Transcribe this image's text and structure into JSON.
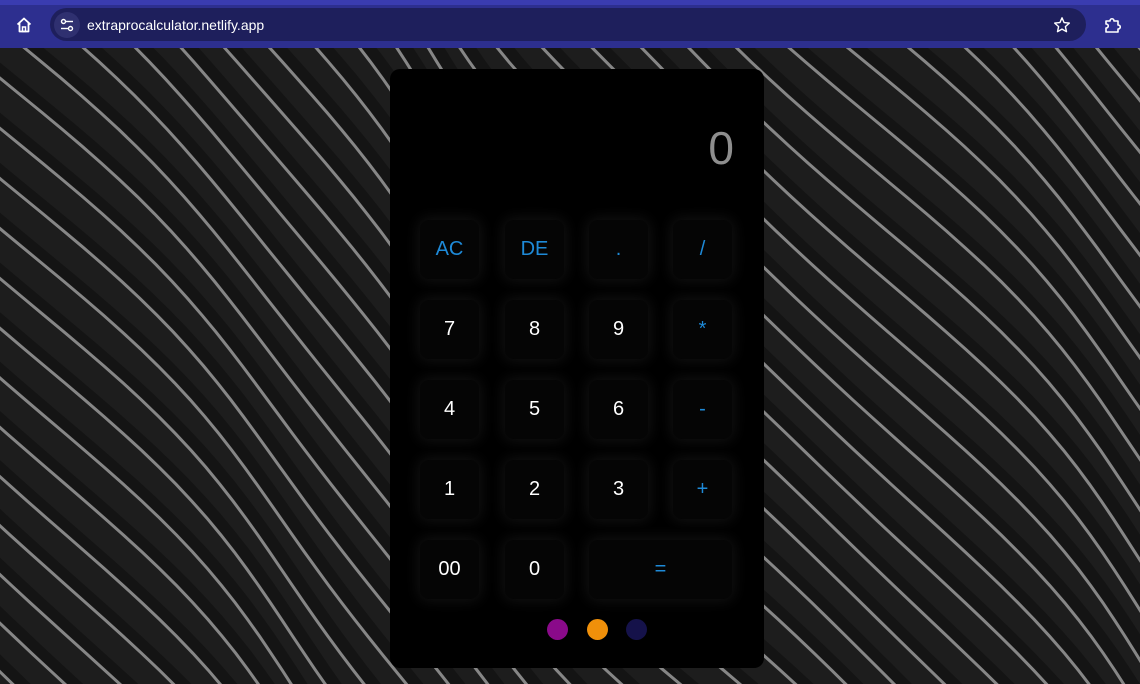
{
  "browser": {
    "url": "extraprocalculator.netlify.app",
    "icons": {
      "home": "home-icon",
      "site_info": "tune-icon",
      "bookmark": "star-icon",
      "extensions": "puzzle-icon"
    }
  },
  "calculator": {
    "display": "0",
    "keys": [
      {
        "label": "AC",
        "type": "op"
      },
      {
        "label": "DE",
        "type": "op"
      },
      {
        "label": ".",
        "type": "op"
      },
      {
        "label": "/",
        "type": "op"
      },
      {
        "label": "7",
        "type": "num"
      },
      {
        "label": "8",
        "type": "num"
      },
      {
        "label": "9",
        "type": "num"
      },
      {
        "label": "*",
        "type": "op"
      },
      {
        "label": "4",
        "type": "num"
      },
      {
        "label": "5",
        "type": "num"
      },
      {
        "label": "6",
        "type": "num"
      },
      {
        "label": "-",
        "type": "op"
      },
      {
        "label": "1",
        "type": "num"
      },
      {
        "label": "2",
        "type": "num"
      },
      {
        "label": "3",
        "type": "num"
      },
      {
        "label": "+",
        "type": "op"
      },
      {
        "label": "00",
        "type": "num"
      },
      {
        "label": "0",
        "type": "num"
      },
      {
        "label": "=",
        "type": "op"
      }
    ],
    "theme_dots": [
      {
        "name": "purple",
        "color": "#8a0a8a"
      },
      {
        "name": "orange",
        "color": "#f0900a"
      },
      {
        "name": "navy",
        "color": "#15124a"
      }
    ]
  },
  "colors": {
    "browser_bar": "#2d2f8f",
    "address_bar": "#1e1f5c",
    "operator_text": "#1e8ad8",
    "number_text": "#ffffff",
    "display_text": "#8e8e8e",
    "calculator_bg": "#000000"
  }
}
